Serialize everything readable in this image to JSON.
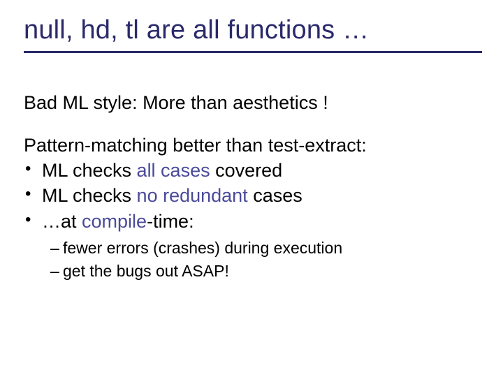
{
  "title": "null, hd, tl are all functions …",
  "subtitle": "Bad ML style: More than aesthetics !",
  "lead": "Pattern-matching better than test-extract:",
  "bullets": [
    {
      "pre": "ML checks ",
      "em": "all cases",
      "post": " covered"
    },
    {
      "pre": "ML checks ",
      "em": "no redundant",
      "post": " cases"
    },
    {
      "pre": "…at ",
      "em": "compile",
      "post": "-time:"
    }
  ],
  "subbullets": [
    "fewer errors (crashes) during execution",
    "get the bugs out ASAP!"
  ]
}
